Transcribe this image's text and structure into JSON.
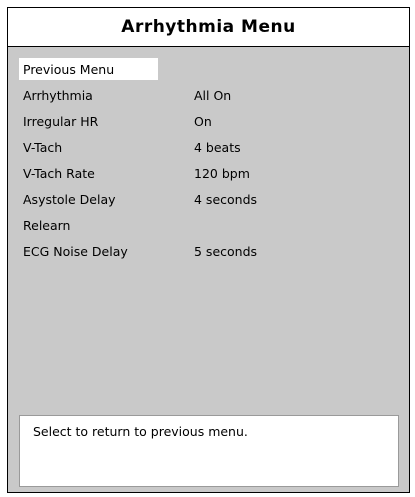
{
  "window": {
    "title": "Arrhythmia Menu"
  },
  "menu": {
    "items": [
      {
        "label": "Previous Menu",
        "value": ""
      },
      {
        "label": "Arrhythmia",
        "value": "All On"
      },
      {
        "label": "Irregular HR",
        "value": "On"
      },
      {
        "label": "V-Tach",
        "value": "4 beats"
      },
      {
        "label": "V-Tach Rate",
        "value": "120 bpm"
      },
      {
        "label": "Asystole Delay",
        "value": "4 seconds"
      },
      {
        "label": "Relearn",
        "value": ""
      },
      {
        "label": "ECG Noise Delay",
        "value": "5 seconds"
      }
    ],
    "selected_index": 0
  },
  "help": {
    "text": "Select to return to previous menu."
  },
  "colors": {
    "panel_background": "#c9c9c9",
    "title_background": "#ffffff",
    "highlight": "#ffffff",
    "text": "#000000"
  }
}
